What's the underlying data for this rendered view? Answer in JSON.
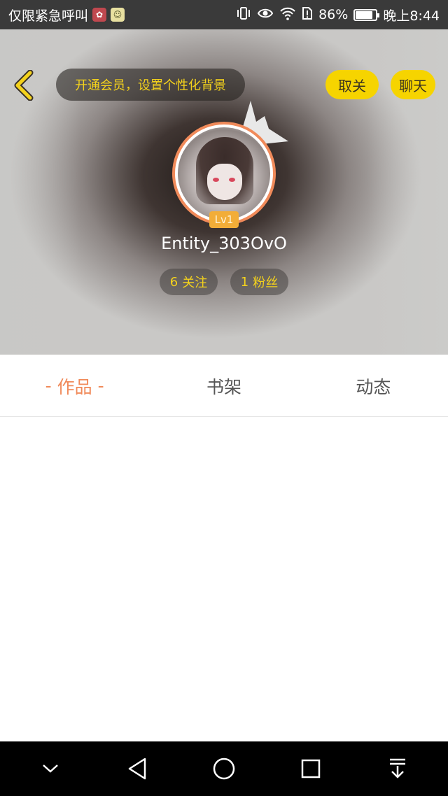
{
  "status_bar": {
    "carrier_text": "仅限紧急呼叫",
    "battery_percent": "86%",
    "battery_level": 0.86,
    "time": "晚上8:44",
    "icons": [
      "app-notification-icon",
      "chat-app-icon",
      "vibrate-icon",
      "eye-icon",
      "wifi-icon",
      "sim-alert-icon",
      "battery-icon"
    ]
  },
  "header": {
    "vip_banner": "开通会员，设置个性化背景",
    "unfollow_label": "取关",
    "chat_label": "聊天",
    "level": "Lv1",
    "username": "Entity_303OvO",
    "follow_count": "6",
    "follow_label": "关注",
    "fans_count": "1",
    "fans_label": "粉丝"
  },
  "tabs": [
    {
      "label": "作品",
      "active": true
    },
    {
      "label": "书架",
      "active": false
    },
    {
      "label": "动态",
      "active": false
    }
  ],
  "nav_bar": {
    "buttons": [
      "collapse-icon",
      "back-icon",
      "home-icon",
      "recents-icon",
      "notification-pull-icon"
    ]
  },
  "colors": {
    "accent_yellow": "#f6d400",
    "accent_orange": "#f08a5a",
    "level_badge": "#f2ad38"
  }
}
